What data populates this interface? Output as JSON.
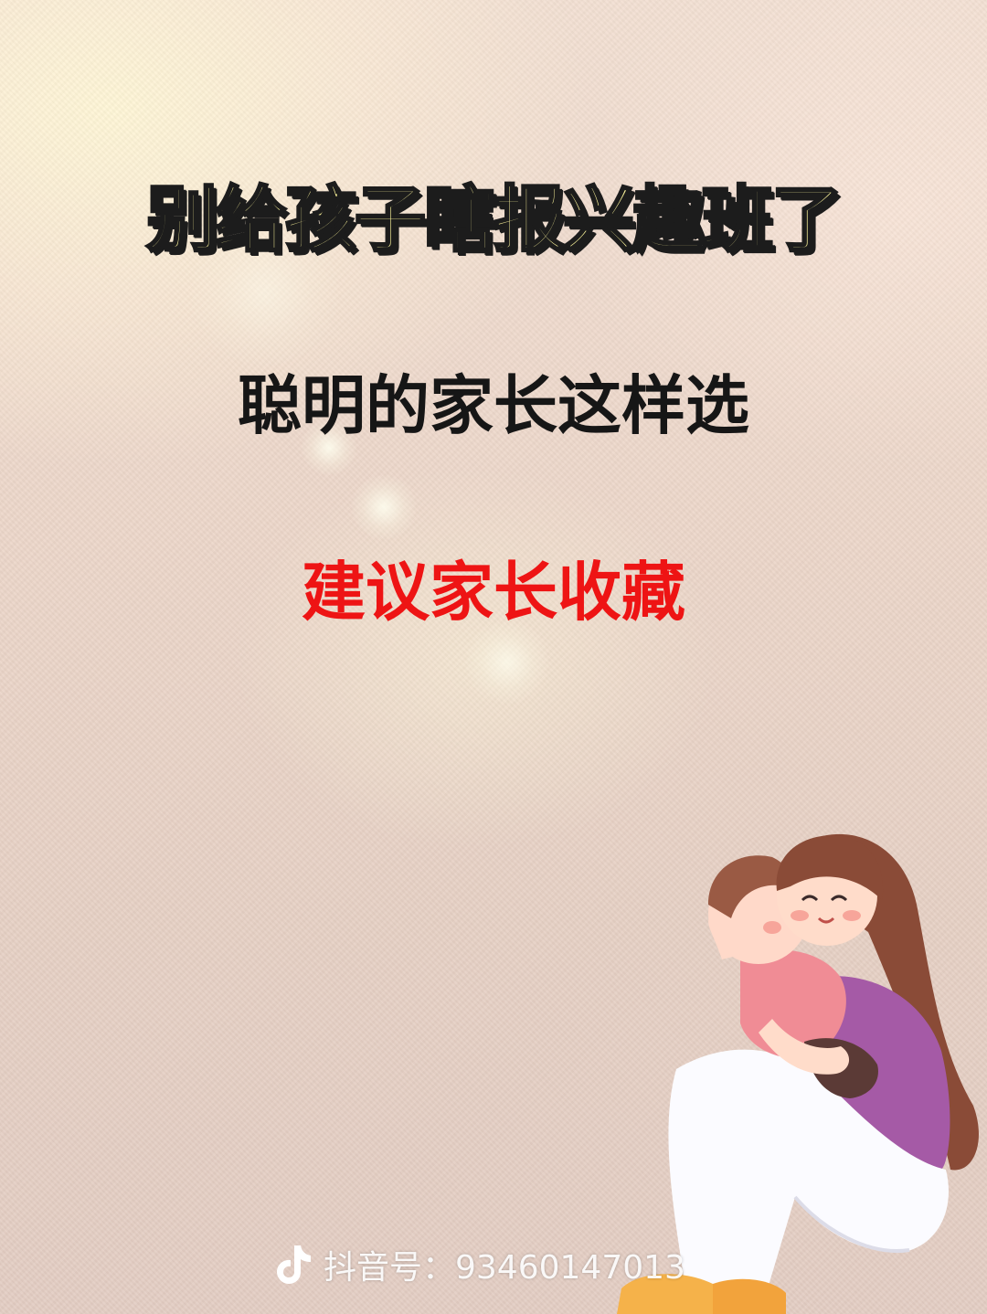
{
  "poster": {
    "headline": "别给孩子瞎报兴趣班了",
    "subtitle": "聪明的家长这样选",
    "advice": "建议家长收藏"
  },
  "watermark": {
    "icon": "douyin-logo-icon",
    "text": "抖音号：93460147013"
  },
  "colors": {
    "headline_fill": "#fbf39a",
    "headline_outline": "#1c1c1c",
    "subtitle": "#161616",
    "advice": "#ee1414",
    "background": "#ecd6c9"
  },
  "illustration": {
    "icon": "mother-hugging-child-illustration"
  }
}
